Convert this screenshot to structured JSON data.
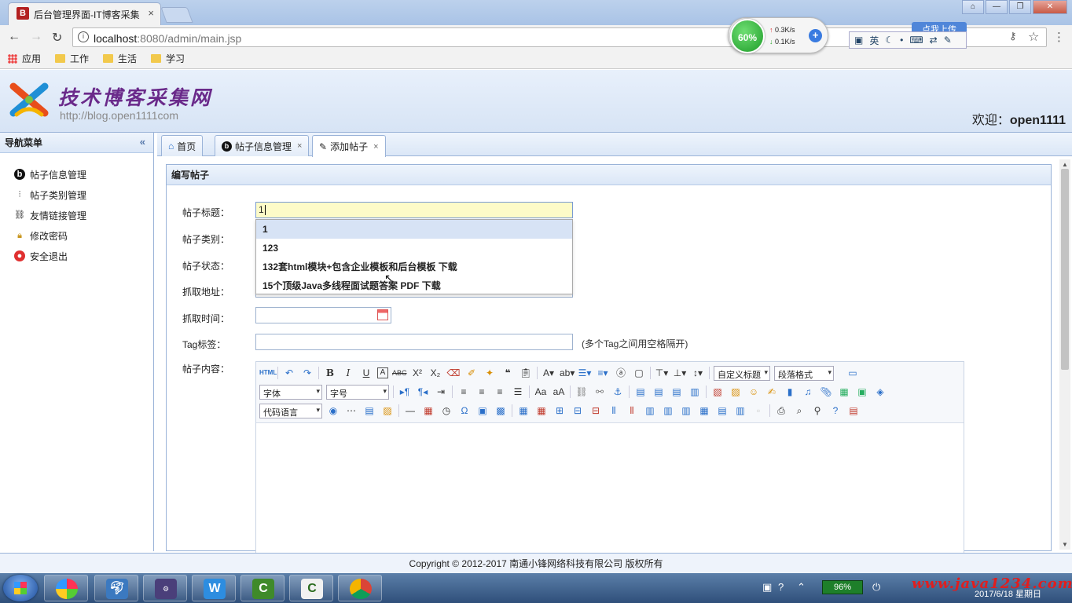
{
  "browser": {
    "tab_title": "后台管理界面-IT博客采集",
    "tab_favicon": "B",
    "url_host": "localhost",
    "url_path": ":8080/admin/main.jsp",
    "bookmarks": [
      "应用",
      "工作",
      "生活",
      "学习"
    ]
  },
  "overlays": {
    "speed_percent": "60%",
    "speed_up": "0.3K/s",
    "speed_down": "0.1K/s",
    "ime_label": "英",
    "upload_label": "点我上传"
  },
  "header": {
    "logo_text": "技术博客采集网",
    "logo_url": "http://blog.open1111com",
    "welcome_prefix": "欢迎：",
    "welcome_user": "open1111"
  },
  "sidebar": {
    "title": "导航菜单",
    "items": [
      {
        "label": "帖子信息管理",
        "icon": "blogger-icon"
      },
      {
        "label": "帖子类别管理",
        "icon": "tree-icon"
      },
      {
        "label": "友情链接管理",
        "icon": "link-icon"
      },
      {
        "label": "修改密码",
        "icon": "lock-icon"
      },
      {
        "label": "安全退出",
        "icon": "exit-icon"
      }
    ]
  },
  "tabs": [
    {
      "label": "首页"
    },
    {
      "label": "帖子信息管理"
    },
    {
      "label": "添加帖子"
    }
  ],
  "panel": {
    "title": "编写帖子"
  },
  "form": {
    "title_label": "帖子标题：",
    "title_value": "1",
    "type_label": "帖子类别：",
    "state_label": "帖子状态：",
    "url_label": "抓取地址：",
    "time_label": "抓取时间：",
    "tag_label": "Tag标签：",
    "tag_hint": "(多个Tag之间用空格隔开)",
    "content_label": "帖子内容："
  },
  "autocomplete": [
    "1",
    "123",
    "132套html模块+包含企业模板和后台模板 下载",
    "15个顶级Java多线程面试题答案 PDF 下载"
  ],
  "editor": {
    "heading_select": "自定义标题",
    "paragraph_select": "段落格式",
    "font_select": "字体",
    "size_select": "字号",
    "code_select": "代码语言"
  },
  "footer": {
    "copyright": "Copyright © 2012-2017 南通小锋网络科技有限公司 版权所有"
  },
  "taskbar": {
    "battery": "96%",
    "watermark": "www.java1234.com",
    "date": "2017/6/18 星期日"
  },
  "colors": {
    "header_bg": "#d7e4f5",
    "border": "#9ab3d8",
    "focus_input": "#fdfbc8",
    "logo_purple": "#6a2a8a"
  }
}
